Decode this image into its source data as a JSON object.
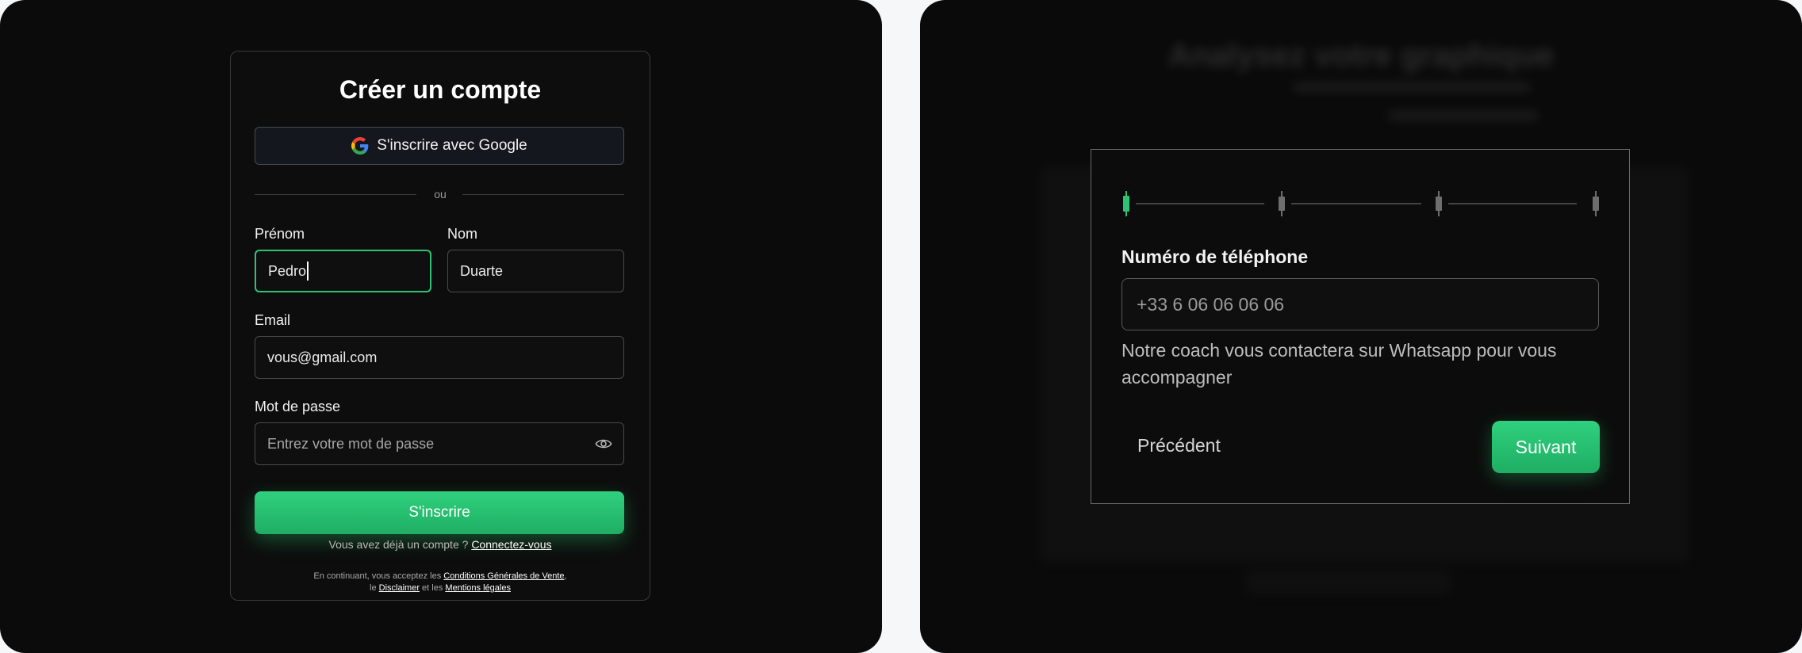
{
  "signup": {
    "title": "Créer un compte",
    "google_button": "S'inscrire avec Google",
    "divider_text": "ou",
    "first_name": {
      "label": "Prénom",
      "value": "Pedro"
    },
    "last_name": {
      "label": "Nom",
      "value": "Duarte"
    },
    "email": {
      "label": "Email",
      "value": "vous@gmail.com"
    },
    "password": {
      "label": "Mot de passe",
      "placeholder": "Entrez votre mot de passe"
    },
    "submit_button": "S'inscrire",
    "login_prompt": "Vous avez déjà un compte ?",
    "login_link": "Connectez-vous",
    "legal": {
      "prefix": "En continuant, vous acceptez les",
      "cgv_link": "Conditions Générales de Vente",
      "comma": ",",
      "line2_prefix": "le",
      "disclaimer_link": "Disclaimer",
      "and": "et les",
      "mentions_link": "Mentions légales"
    }
  },
  "onboarding": {
    "background_title": "Analysez votre graphique",
    "stepper": {
      "total_steps": 4,
      "current_step": 1
    },
    "phone_label": "Numéro de téléphone",
    "phone_placeholder": "+33 6 06 06 06 06",
    "helper_text": "Notre coach vous contactera sur Whatsapp pour vous accompagner",
    "prev_button": "Précédent",
    "next_button": "Suivant"
  },
  "colors": {
    "accent_green": "#2fc275",
    "panel_bg": "#0b0b0b",
    "page_bg": "#f6f7f9"
  }
}
